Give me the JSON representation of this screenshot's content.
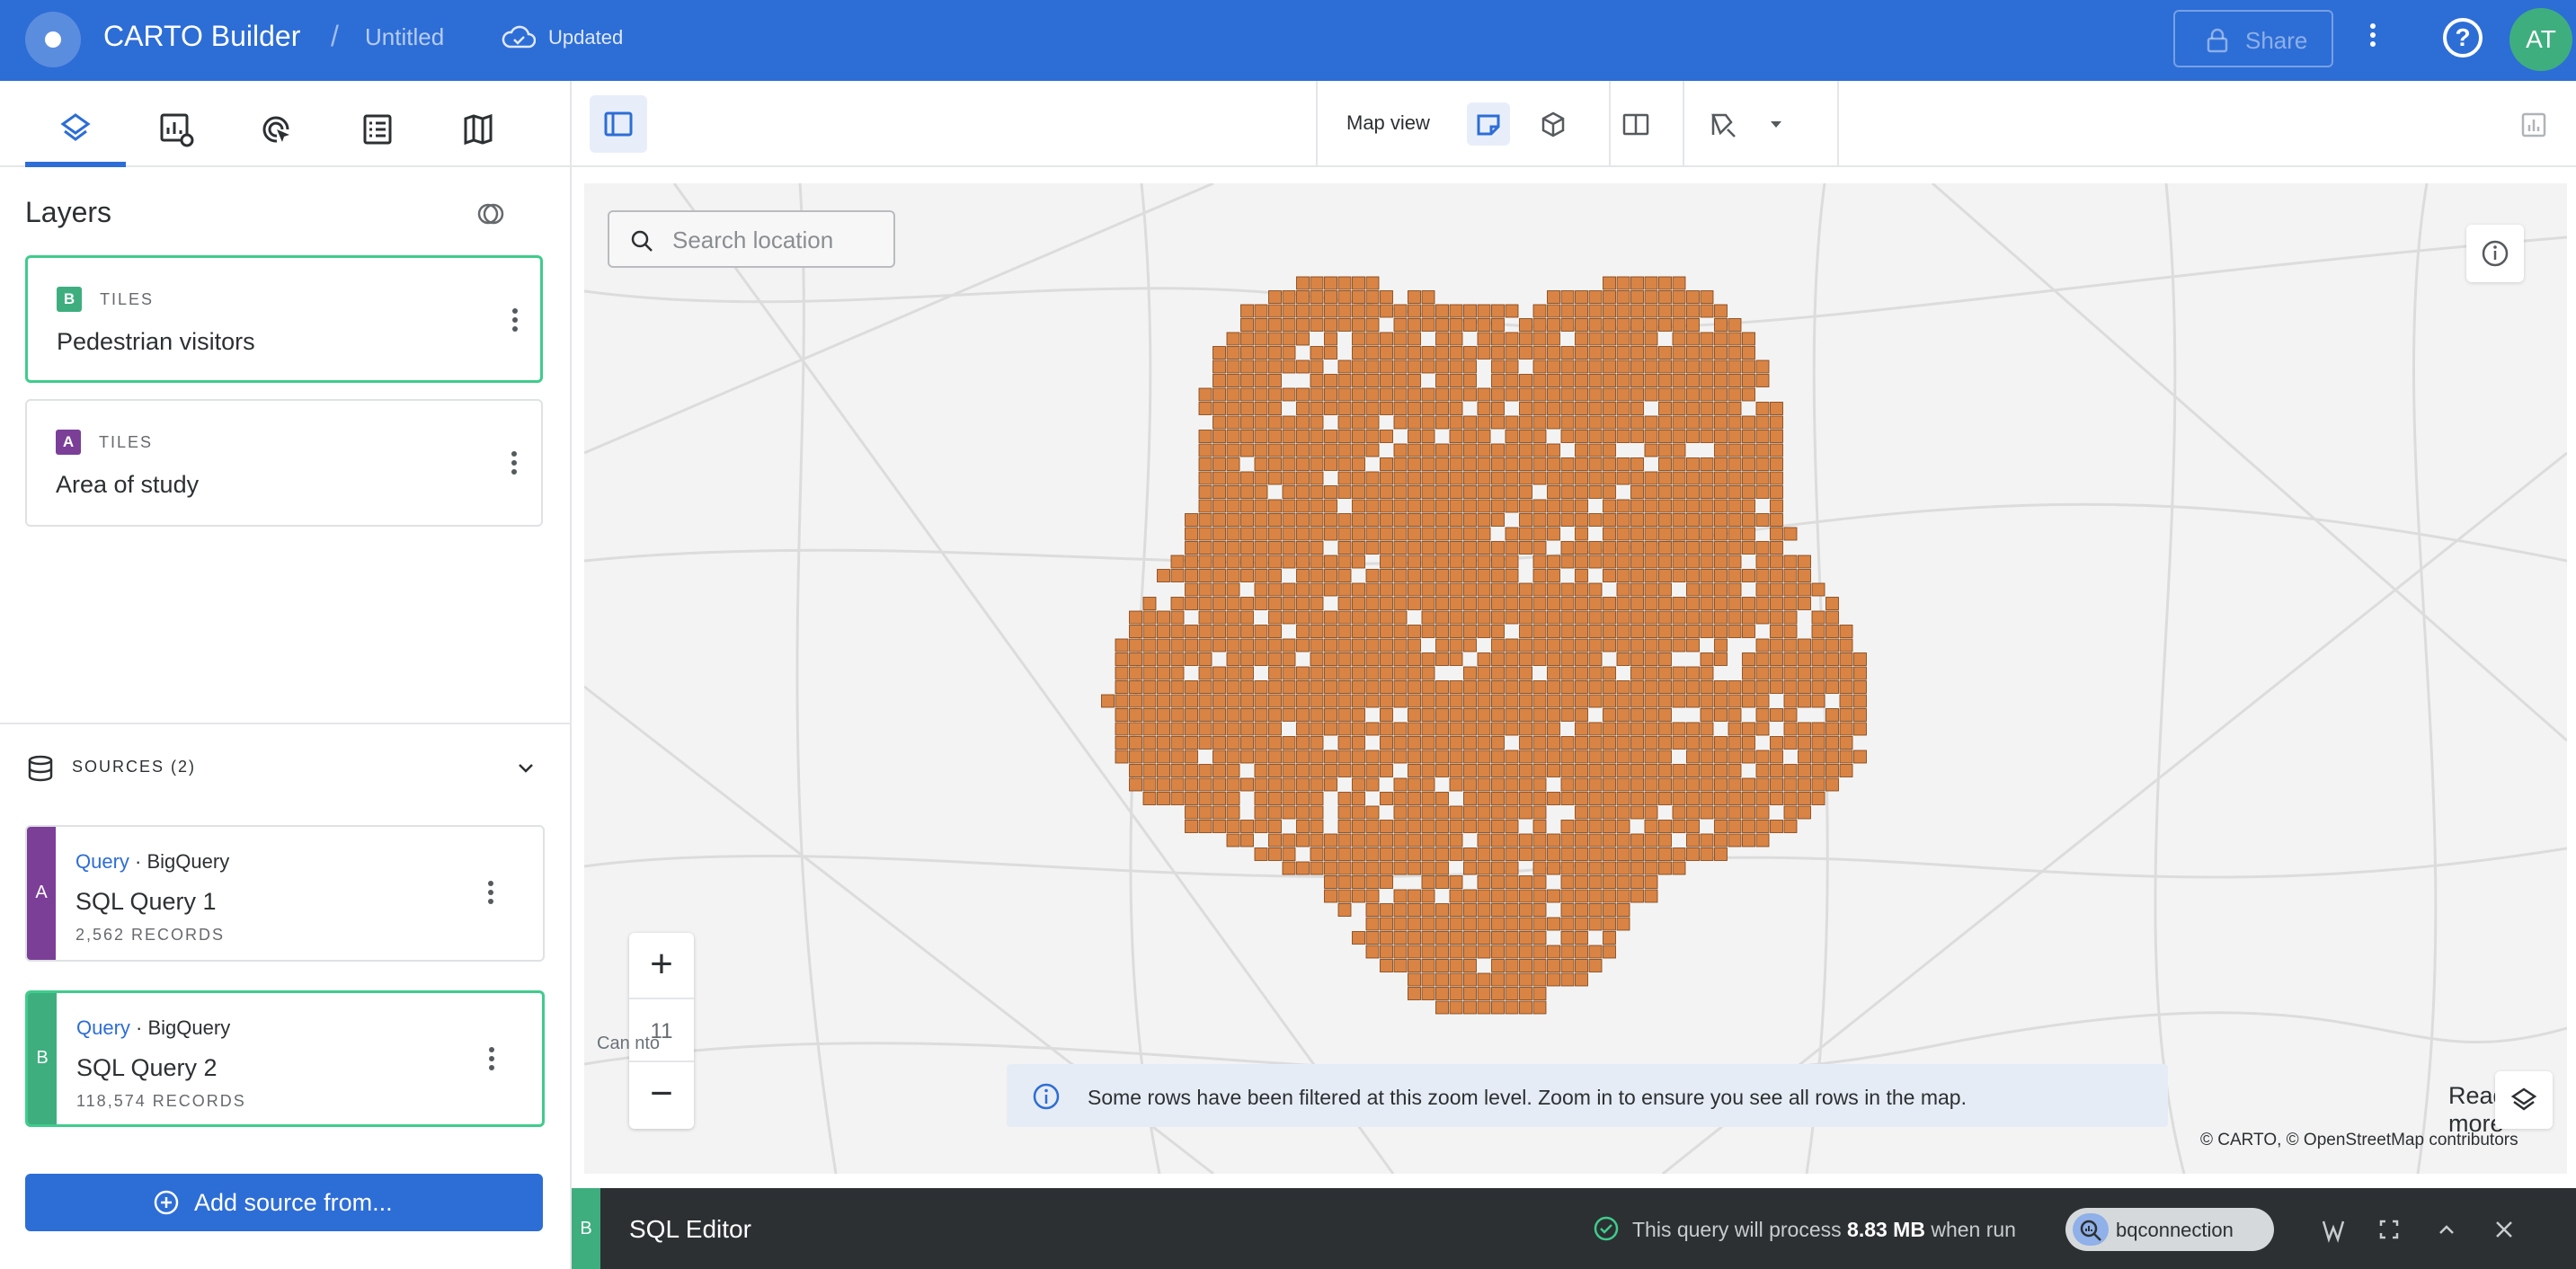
{
  "header": {
    "app_title": "CARTO Builder",
    "separator": "/",
    "map_title": "Untitled",
    "status": "Updated",
    "share_label": "Share",
    "avatar_initials": "AT",
    "brand_color": "#2d6dd6"
  },
  "left_tabs": [
    "layers-icon",
    "widgets-settings-icon",
    "interactions-icon",
    "legend-icon",
    "basemap-icon"
  ],
  "layers": {
    "title": "Layers",
    "items": [
      {
        "badge": "B",
        "badge_color": "#3fae7f",
        "type": "TILES",
        "name": "Pedestrian visitors",
        "selected": true
      },
      {
        "badge": "A",
        "badge_color": "#7b3f98",
        "type": "TILES",
        "name": "Area of study",
        "selected": false
      }
    ]
  },
  "sources": {
    "label": "SOURCES (2)",
    "items": [
      {
        "strip": "A",
        "strip_color": "#7b3f98",
        "kind": "Query",
        "provider": "· BigQuery",
        "name": "SQL Query 1",
        "records": "2,562 RECORDS",
        "selected": false
      },
      {
        "strip": "B",
        "strip_color": "#3fae7f",
        "kind": "Query",
        "provider": "· BigQuery",
        "name": "SQL Query 2",
        "records": "118,574 RECORDS",
        "selected": true
      }
    ],
    "add_label": "Add source from..."
  },
  "toolbar": {
    "map_view_label": "Map view"
  },
  "map": {
    "search_placeholder": "Search location",
    "zoom_in": "+",
    "zoom_level": "11",
    "zoom_out": "−",
    "place_label": "Can       nto",
    "notice_text": "Some rows have been filtered at this zoom level. Zoom in to ensure you see all rows in the map.",
    "notice_link": "Read more",
    "attribution": "© CARTO, © OpenStreetMap contributors",
    "cell_color": "#d98444"
  },
  "sql": {
    "strip": "B",
    "title": "SQL Editor",
    "process_prefix": "This query will process",
    "process_size": "8.83 MB",
    "process_suffix": "when run",
    "connection": "bqconnection"
  }
}
